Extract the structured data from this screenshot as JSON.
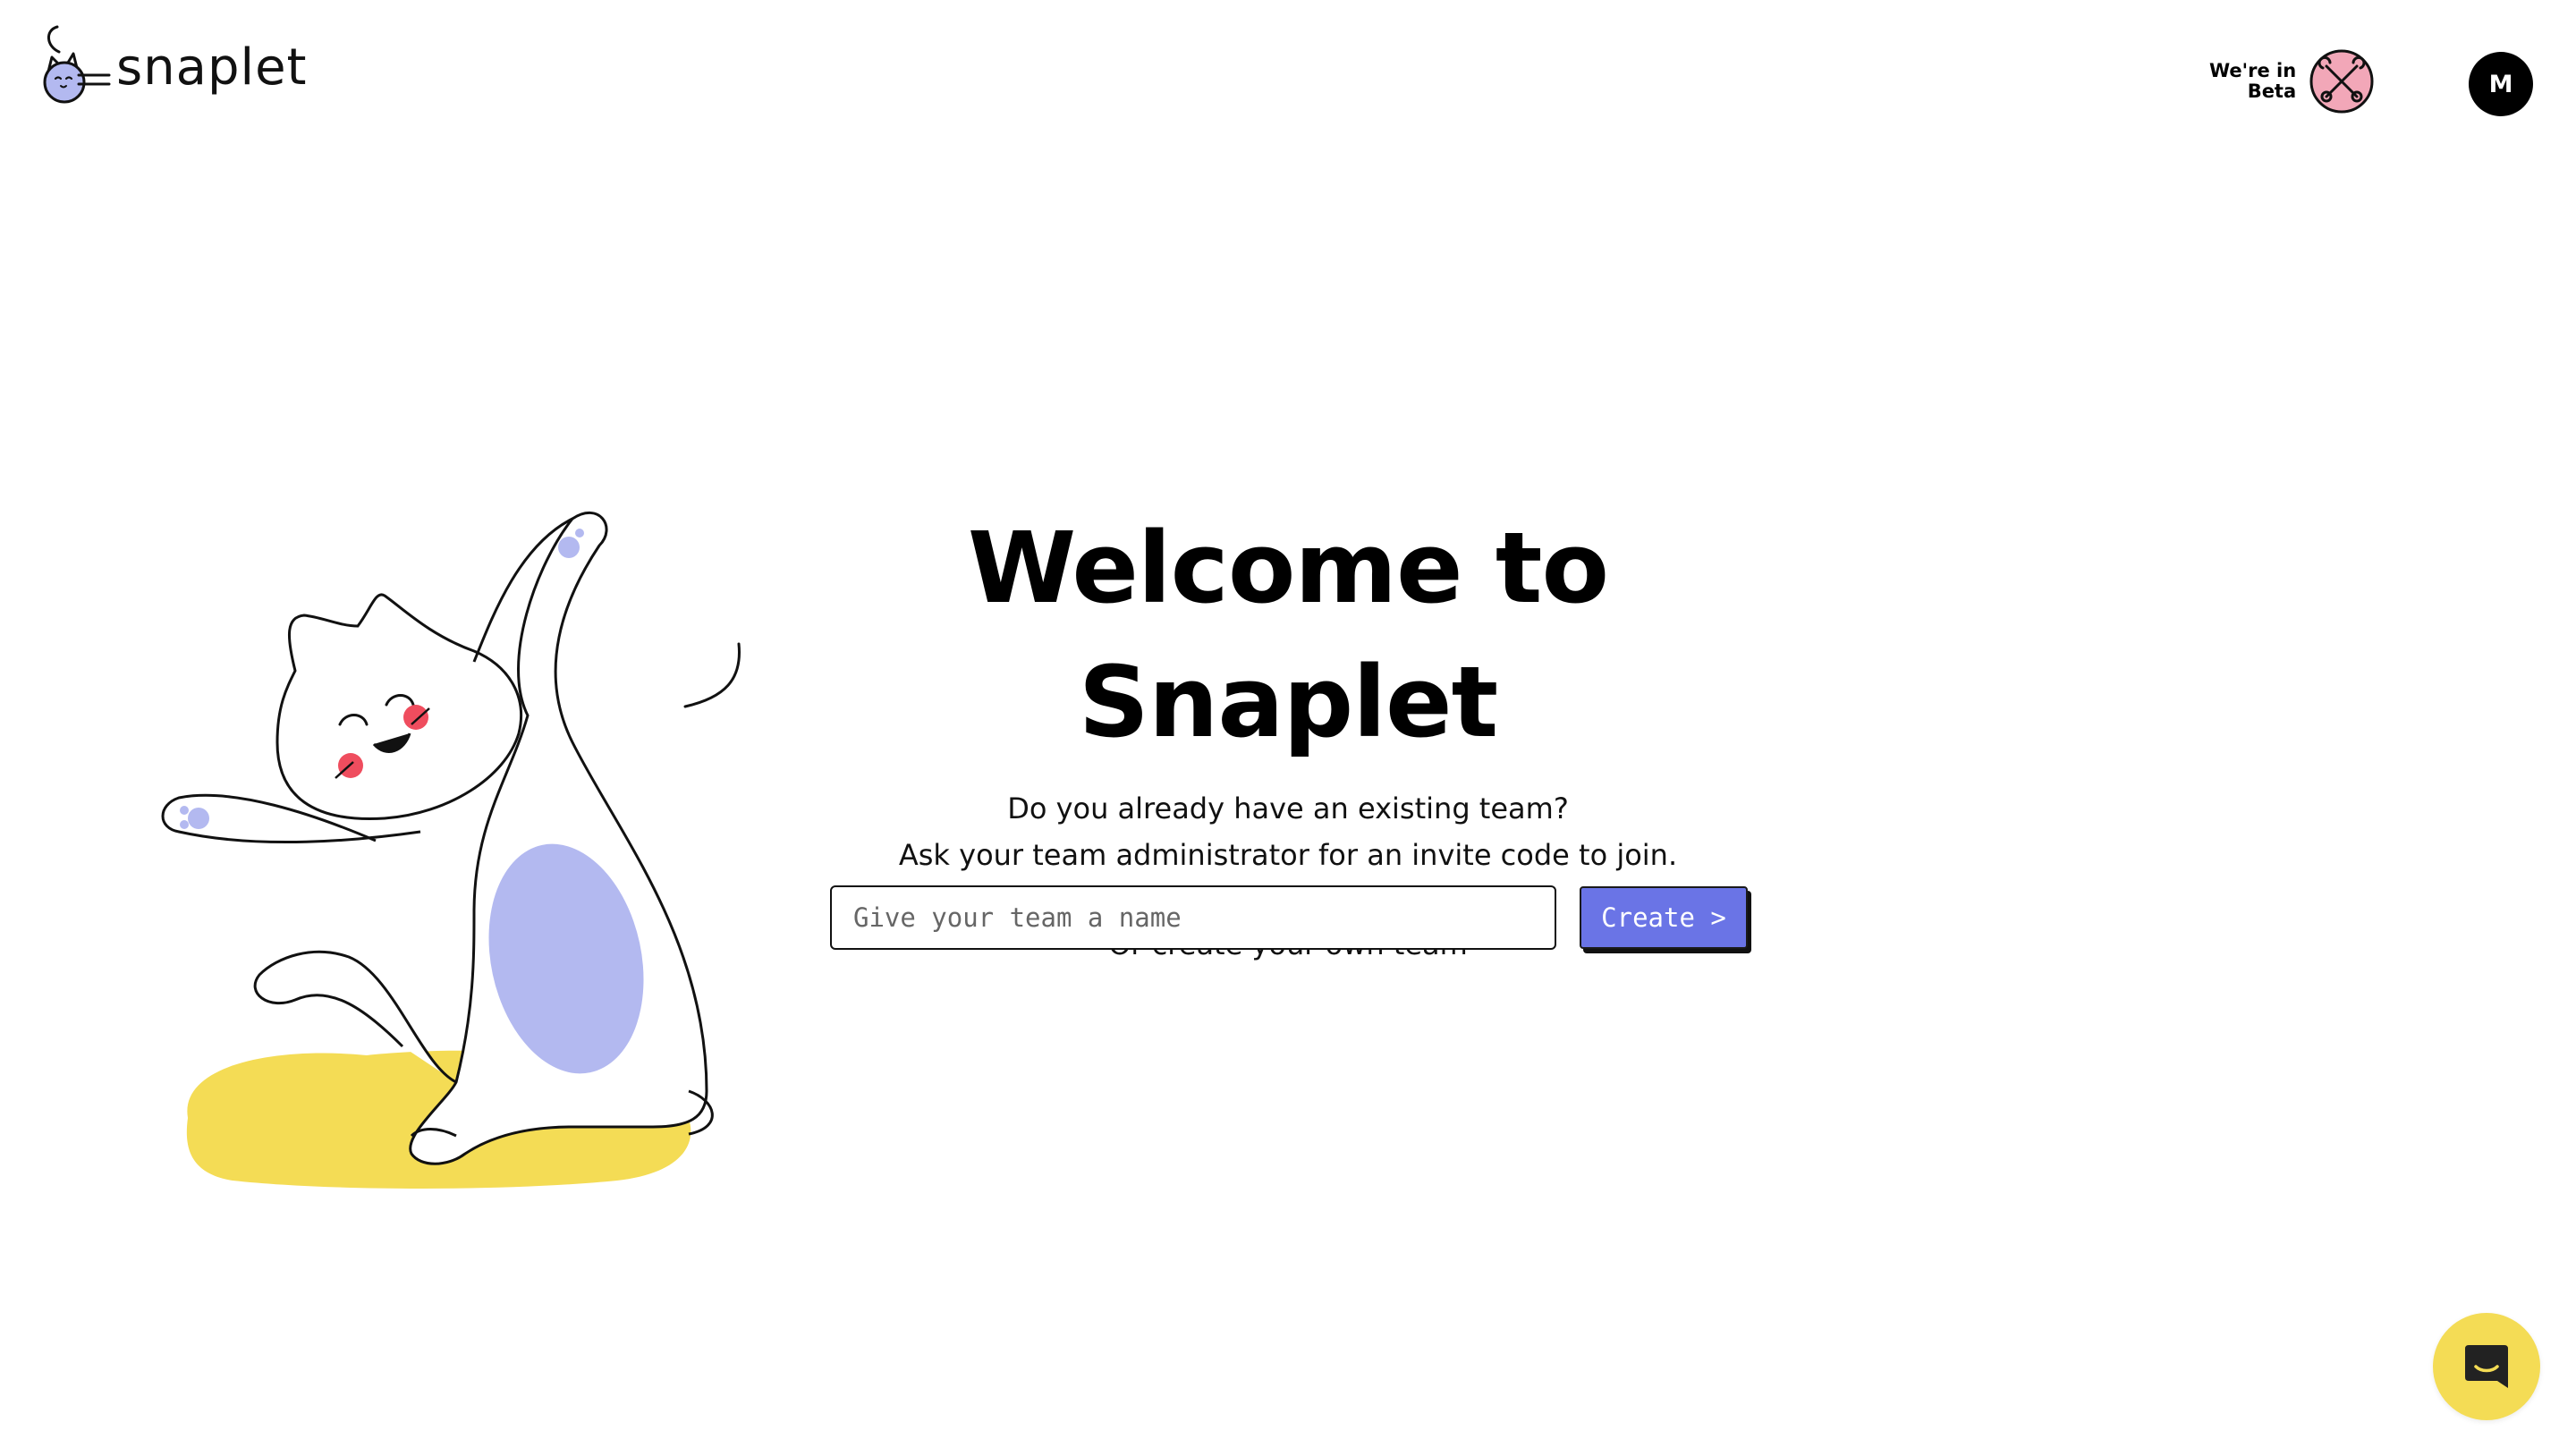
{
  "header": {
    "brand_name": "snaplet",
    "beta_line1": "We're in",
    "beta_line2": "Beta",
    "avatar_initial": "M"
  },
  "main": {
    "title": "Welcome to Snaplet",
    "line1": "Do you already have an existing team?",
    "line2": "Ask your team administrator for an invite code to join.",
    "or_line": "Or create your own team",
    "team_input_placeholder": "Give your team a name",
    "team_input_value": "",
    "create_label": "Create >"
  },
  "icons": {
    "beta_badge": "tools-icon",
    "chat": "chat-icon",
    "illustration": "dancing-cat-illustration"
  },
  "colors": {
    "accent": "#6a74e6",
    "chat_launcher": "#f4dc55",
    "beta_badge": "#f2a7b8",
    "cat_belly": "#b3b9f0",
    "floor": "#f4dc55"
  }
}
